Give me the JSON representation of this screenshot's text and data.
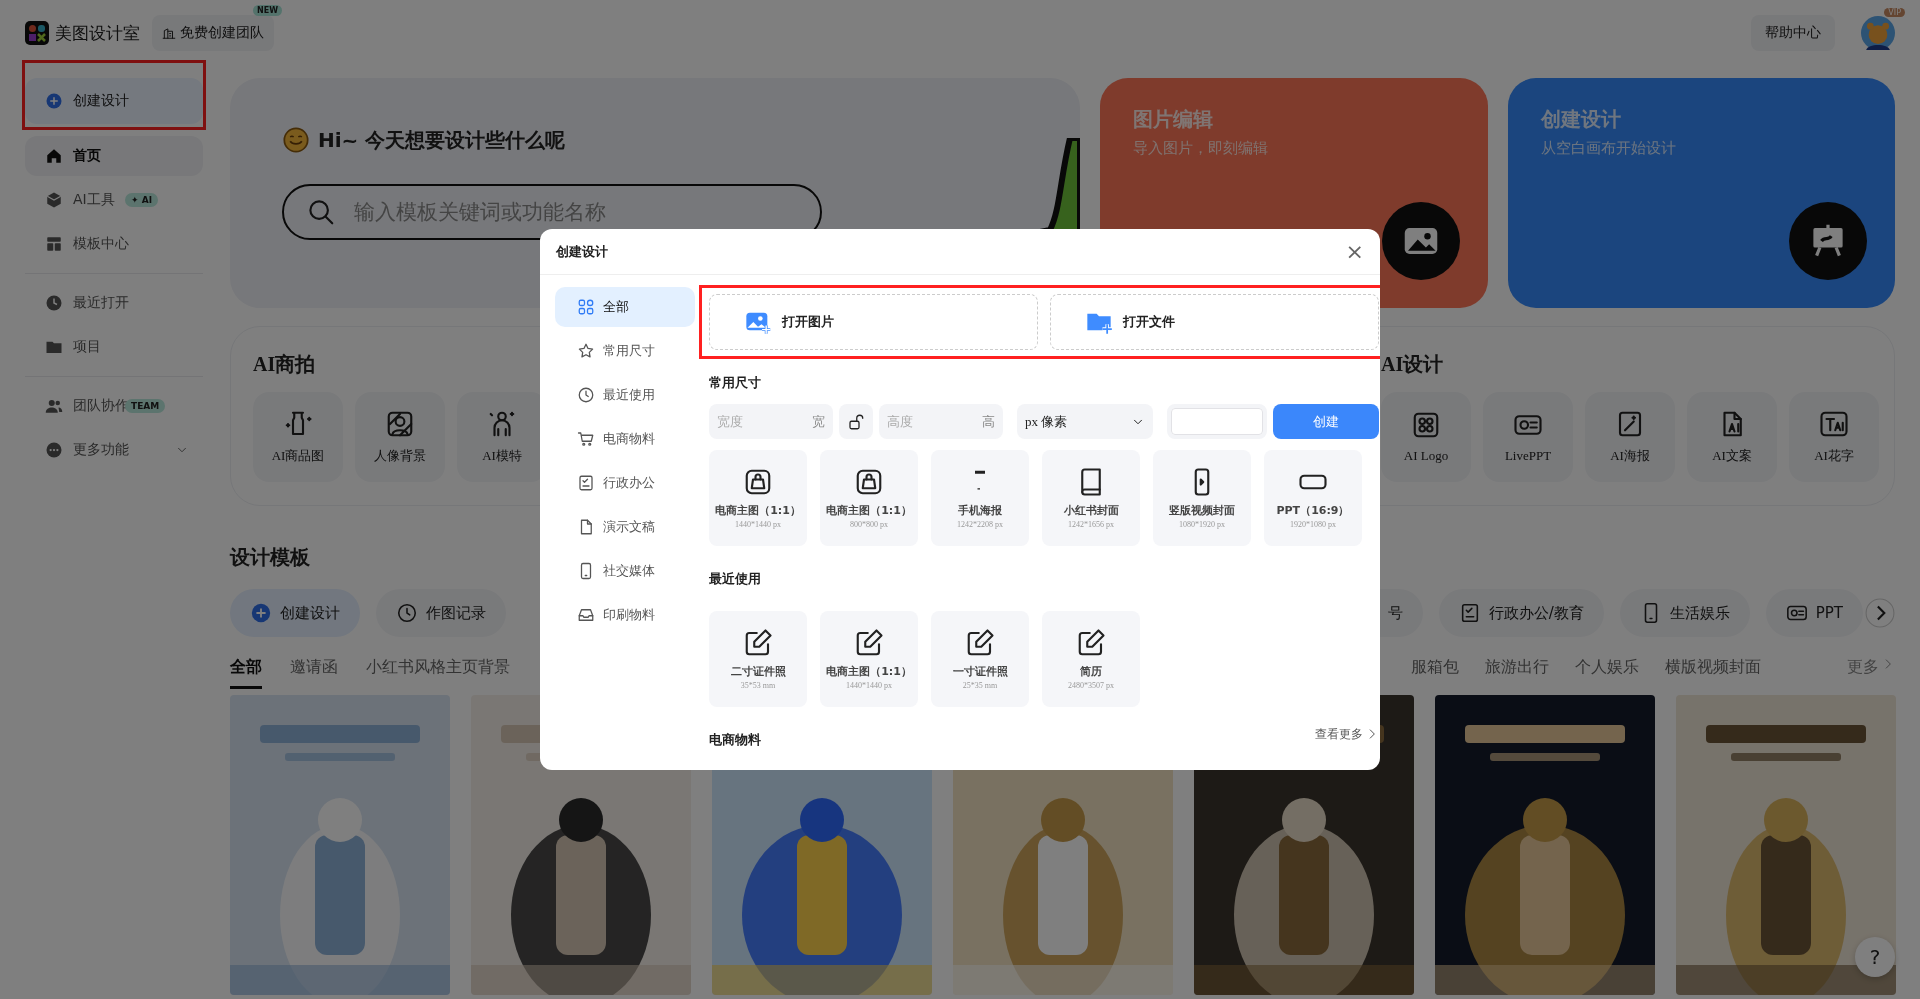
{
  "topbar": {
    "brand": "美图设计室",
    "team_button": "免费创建团队",
    "team_badge": "NEW",
    "help": "帮助中心",
    "avatar_badge": "VIP"
  },
  "sidebar": {
    "create": {
      "label": "创建设计",
      "highlighted": true
    },
    "groups": [
      [
        {
          "label": "首页",
          "selected": true
        },
        {
          "label": "AI工具",
          "badge": "✦ AI",
          "selected": false
        },
        {
          "label": "模板中心",
          "selected": false
        }
      ],
      [
        {
          "label": "最近打开",
          "selected": false
        },
        {
          "label": "项目",
          "selected": false
        }
      ],
      [
        {
          "label": "团队协作",
          "badge": "TEAM",
          "selected": false
        },
        {
          "label": "更多功能",
          "expandable": true,
          "selected": false
        }
      ]
    ]
  },
  "hero": {
    "greeting": "Hi~ 今天想要设计些什么呢",
    "search_placeholder": "输入模板关键词或功能名称"
  },
  "feature_cards": [
    {
      "title": "图片编辑",
      "subtitle": "导入图片，即刻编辑"
    },
    {
      "title": "创建设计",
      "subtitle": "从空白画布开始设计"
    }
  ],
  "ai_shoot": {
    "title": "AI商拍",
    "tools": [
      {
        "label": "AI商品图"
      },
      {
        "label": "人像背景"
      },
      {
        "label": "AI模特"
      }
    ]
  },
  "ai_design": {
    "title": "AI设计",
    "tools": [
      {
        "label": "AI Logo"
      },
      {
        "label": "LivePPT"
      },
      {
        "label": "AI海报"
      },
      {
        "label": "AI文案"
      },
      {
        "label": "AI花字"
      }
    ]
  },
  "templates": {
    "title": "设计模板",
    "categories_left": [
      {
        "label": "创建设计",
        "primary": true
      },
      {
        "label": "作图记录",
        "primary": false
      }
    ],
    "categories_right": [
      {
        "label": "号"
      },
      {
        "label": "行政办公/教育"
      },
      {
        "label": "生活娱乐"
      },
      {
        "label": "PPT"
      }
    ],
    "tabs_left": [
      {
        "label": "全部",
        "selected": true
      },
      {
        "label": "邀请函",
        "selected": false
      },
      {
        "label": "小红书风格主页背景",
        "selected": false
      }
    ],
    "tabs_right": [
      {
        "label": "服箱包",
        "selected": false
      },
      {
        "label": "旅游出行",
        "selected": false
      },
      {
        "label": "个人娱乐",
        "selected": false
      },
      {
        "label": "横版视频封面",
        "selected": false
      }
    ],
    "more": "更多"
  },
  "help_button": "?",
  "dialog": {
    "title": "创建设计",
    "close": "×",
    "nav": [
      {
        "label": "全部",
        "selected": true
      },
      {
        "label": "常用尺寸",
        "selected": false
      },
      {
        "label": "最近使用",
        "selected": false
      },
      {
        "label": "电商物料",
        "selected": false
      },
      {
        "label": "行政办公",
        "selected": false
      },
      {
        "label": "演示文稿",
        "selected": false
      },
      {
        "label": "社交媒体",
        "selected": false
      },
      {
        "label": "印刷物料",
        "selected": false
      }
    ],
    "open_actions": {
      "highlighted": true,
      "items": [
        {
          "label": "打开图片"
        },
        {
          "label": "打开文件"
        }
      ]
    },
    "common": {
      "title": "常用尺寸",
      "width_placeholder": "宽度",
      "width_unit": "宽",
      "height_placeholder": "高度",
      "height_unit": "高",
      "unit": "px 像素",
      "create": "创建",
      "sizes": [
        {
          "name": "电商主图（1:1）",
          "dims": "1440*1440 px"
        },
        {
          "name": "电商主图（1:1）",
          "dims": "800*800 px"
        },
        {
          "name": "手机海报",
          "dims": "1242*2208 px"
        },
        {
          "name": "小红书封面",
          "dims": "1242*1656 px"
        },
        {
          "name": "竖版视频封面",
          "dims": "1080*1920 px"
        },
        {
          "name": "PPT（16:9）",
          "dims": "1920*1080 px"
        }
      ]
    },
    "recent": {
      "title": "最近使用",
      "items": [
        {
          "name": "二寸证件照",
          "dims": "35*53 mm"
        },
        {
          "name": "电商主图（1:1）",
          "dims": "1440*1440 px"
        },
        {
          "name": "一寸证件照",
          "dims": "25*35 mm"
        },
        {
          "name": "简历",
          "dims": "2480*3507 px"
        }
      ]
    },
    "ecommerce": {
      "title": "电商物料",
      "more": "查看更多"
    }
  }
}
